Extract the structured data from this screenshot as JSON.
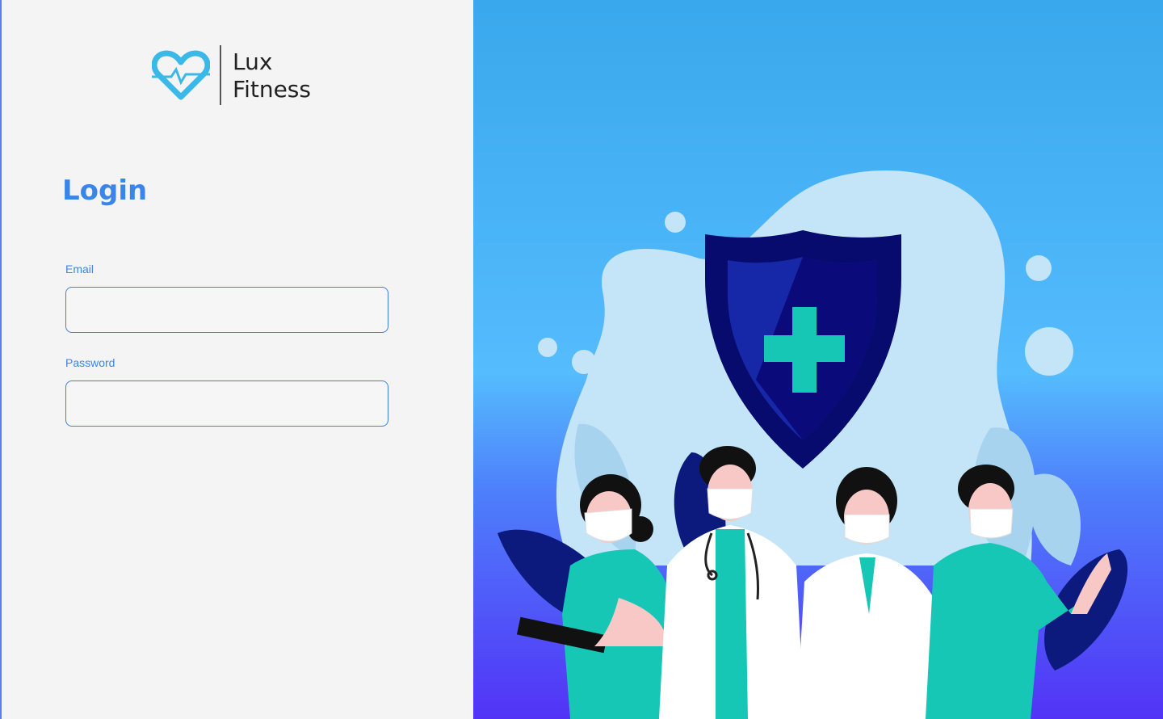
{
  "brand": {
    "name_line1": "Lux",
    "name_line2": "Fitness",
    "logo_icon": "heart-pulse-icon",
    "accent_color": "#3ab8e8"
  },
  "login": {
    "title": "Login",
    "email_label": "Email",
    "email_value": "",
    "password_label": "Password",
    "password_value": ""
  },
  "colors": {
    "primary": "#3a86e8",
    "panel_background": "#f4f4f4",
    "hero_gradient_top": "#3aa8ec",
    "hero_gradient_bottom": "#5233f6",
    "shield": "#0a0a7a",
    "cross": "#17c7b5"
  },
  "illustration": {
    "subject": "medical-team-with-shield-illustration"
  }
}
